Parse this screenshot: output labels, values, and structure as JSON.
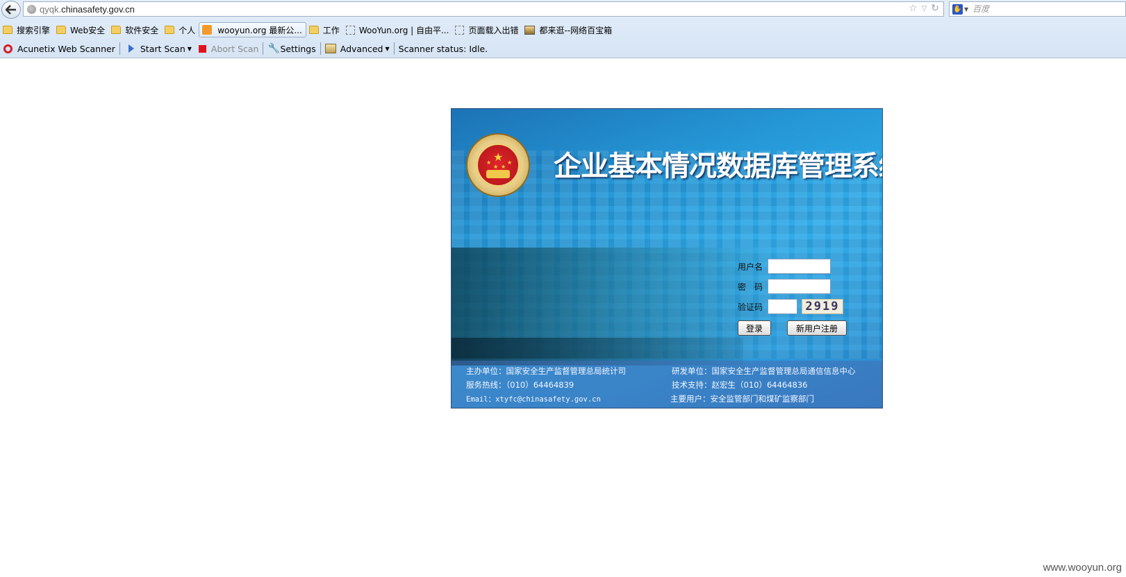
{
  "browser": {
    "url_sub": "qyqk.",
    "url_domain": "chinasafety.gov.cn",
    "search_placeholder": "百度"
  },
  "bookmarks": [
    {
      "label": "搜索引擎",
      "icon": "folder-icon"
    },
    {
      "label": "Web安全",
      "icon": "folder-icon"
    },
    {
      "label": "软件安全",
      "icon": "folder-icon"
    },
    {
      "label": "个人",
      "icon": "folder-icon"
    },
    {
      "label": "wooyun.org 最新公...",
      "icon": "rss-icon"
    },
    {
      "label": "工作",
      "icon": "folder-icon"
    },
    {
      "label": "WooYun.org | 自由平...",
      "icon": "page-icon"
    },
    {
      "label": "页面载入出错",
      "icon": "page-icon"
    },
    {
      "label": "都来逛--网络百宝箱",
      "icon": "image-icon"
    }
  ],
  "scanner_toolbar": {
    "brand": "Acunetix Web Scanner",
    "start": "Start Scan",
    "abort": "Abort Scan",
    "settings": "Settings",
    "advanced": "Advanced",
    "status": "Scanner status: Idle."
  },
  "login": {
    "title": "企业基本情况数据库管理系统",
    "username_label": "用户名",
    "password_label": "密　码",
    "captcha_label": "验证码",
    "captcha_value": "2919",
    "login_button": "登录",
    "register_button": "新用户注册"
  },
  "footer": {
    "sponsor": "主办单位：国家安全生产监督管理总局统计司",
    "developer": "研发单位：国家安全生产监督管理总局通信信息中心",
    "hotline": "服务热线：（010）64464839",
    "support": "技术支持：赵宏生（010）64464836",
    "email": "Email：xtyfc@chinasafety.gov.cn",
    "main_users": "主要用户：安全监管部门和煤矿监察部门"
  },
  "watermark": "www.wooyun.org",
  "colors": {
    "panel_blue": "#2597d6",
    "abort_red": "#e0141e",
    "acunetix_red": "#d61e2a"
  }
}
